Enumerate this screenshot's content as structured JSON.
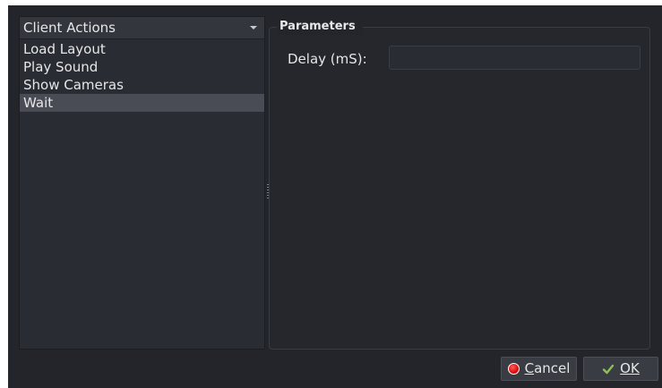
{
  "category_select": {
    "value": "Client Actions"
  },
  "actions": [
    {
      "label": "Load Layout",
      "selected": false
    },
    {
      "label": "Play Sound",
      "selected": false
    },
    {
      "label": "Show Cameras",
      "selected": false
    },
    {
      "label": "Wait",
      "selected": true
    }
  ],
  "parameters": {
    "title": "Parameters",
    "delay_label": "Delay (mS):",
    "delay_value": ""
  },
  "buttons": {
    "cancel_first": "C",
    "cancel_rest": "ancel",
    "ok_first": "O",
    "ok_rest": "K"
  },
  "colors": {
    "background": "#23252b",
    "selected_row": "#4a4c55",
    "cancel_icon": "#e01313",
    "ok_icon": "#8fbf5a"
  },
  "icons": {
    "dropdown": "chevron-down-icon",
    "cancel": "red-circle-icon",
    "ok": "checkmark-icon"
  }
}
